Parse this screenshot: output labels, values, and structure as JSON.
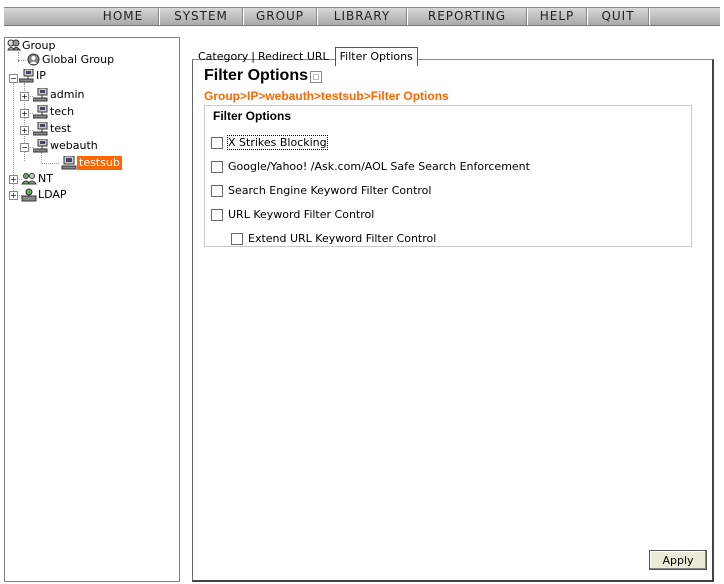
{
  "menu": {
    "items": [
      "HOME",
      "SYSTEM",
      "GROUP",
      "LIBRARY",
      "REPORTING",
      "HELP",
      "QUIT"
    ]
  },
  "tree": {
    "root": "Group",
    "global_group": "Global Group",
    "ip": "IP",
    "admin": "admin",
    "tech": "tech",
    "test": "test",
    "webauth": "webauth",
    "testsub": "testsub",
    "nt": "NT",
    "ldap": "LDAP"
  },
  "tabs": {
    "category": "Category",
    "redirect": "Redirect URL",
    "filter": "Filter Options"
  },
  "page": {
    "title": "Filter Options",
    "breadcrumb": "Group>IP>webauth>testsub>Filter Options"
  },
  "filter_box": {
    "legend": "Filter Options",
    "options": [
      {
        "label": "X Strikes Blocking",
        "checked": false
      },
      {
        "label": "Google/Yahoo! /Ask.com/AOL Safe Search Enforcement",
        "checked": false
      },
      {
        "label": "Search Engine Keyword Filter Control",
        "checked": false
      },
      {
        "label": "URL Keyword Filter Control",
        "checked": false
      },
      {
        "label": "Extend URL Keyword Filter Control",
        "checked": false
      }
    ]
  },
  "apply_label": "Apply",
  "colors": {
    "accent": "#ff6600"
  }
}
